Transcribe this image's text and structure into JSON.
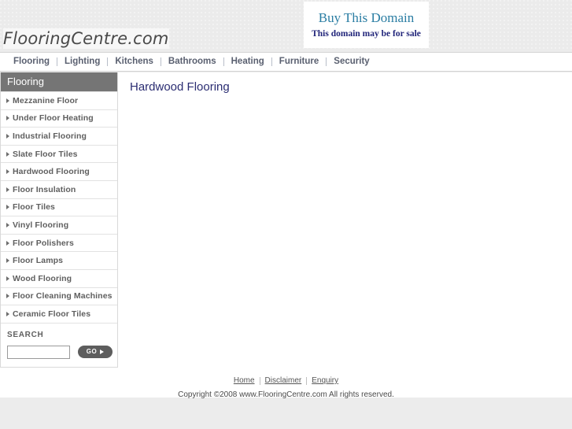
{
  "header": {
    "logo_text": "FlooringCentre.com",
    "banner": {
      "title": "Buy This Domain",
      "subtitle": "This domain may be for sale"
    }
  },
  "nav": {
    "items": [
      {
        "label": "Flooring"
      },
      {
        "label": "Lighting"
      },
      {
        "label": "Kitchens"
      },
      {
        "label": "Bathrooms"
      },
      {
        "label": "Heating"
      },
      {
        "label": "Furniture"
      },
      {
        "label": "Security"
      }
    ]
  },
  "sidebar": {
    "title": "Flooring",
    "items": [
      {
        "label": "Mezzanine Floor"
      },
      {
        "label": "Under Floor Heating"
      },
      {
        "label": "Industrial Flooring"
      },
      {
        "label": "Slate Floor Tiles"
      },
      {
        "label": "Hardwood Flooring"
      },
      {
        "label": "Floor Insulation"
      },
      {
        "label": "Floor Tiles"
      },
      {
        "label": "Vinyl Flooring"
      },
      {
        "label": "Floor Polishers"
      },
      {
        "label": "Floor Lamps"
      },
      {
        "label": "Wood Flooring"
      },
      {
        "label": "Floor Cleaning Machines"
      },
      {
        "label": "Ceramic Floor Tiles"
      }
    ],
    "search": {
      "label": "SEARCH",
      "value": "",
      "placeholder": "",
      "button_label": "GO"
    }
  },
  "main": {
    "title": "Hardwood Flooring"
  },
  "footer": {
    "links": [
      {
        "label": "Home"
      },
      {
        "label": "Disclaimer"
      },
      {
        "label": "Enquiry"
      }
    ],
    "copyright": "Copyright ©2008 www.FlooringCentre.com All rights reserved."
  },
  "colors": {
    "page_background": "#ececec",
    "header_background": "#ebebeb",
    "sidebar_title_background": "#757575",
    "banner_title": "#2a7da3",
    "banner_subtitle": "#21257a",
    "page_title": "#2b2d72",
    "nav_text": "#5a6070",
    "go_button": "#5d5d5d"
  }
}
